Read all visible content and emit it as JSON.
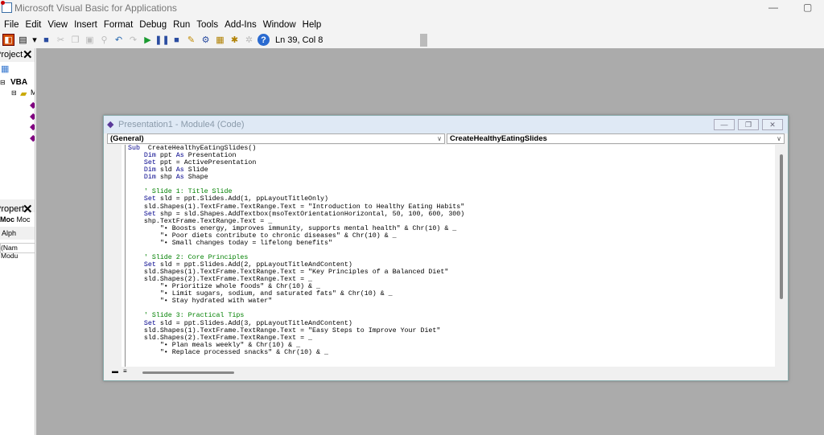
{
  "app_title": "Microsoft Visual Basic for Applications",
  "menu": [
    "File",
    "Edit",
    "View",
    "Insert",
    "Format",
    "Debug",
    "Run",
    "Tools",
    "Add-Ins",
    "Window",
    "Help"
  ],
  "status": "Ln 39, Col 8",
  "project_panel": {
    "title": "Project",
    "root": "VBA",
    "folder": "M"
  },
  "properties_panel": {
    "title": "Propert",
    "object_label": "Moc",
    "object_combo": "Moc",
    "tab": "Alph",
    "name_row": "(Nam Modu"
  },
  "code_window": {
    "title": "Presentation1 - Module4 (Code)",
    "object_combo": "(General)",
    "proc_combo": "CreateHealthyEatingSlides",
    "lines": [
      [
        [
          "kw",
          "Sub"
        ],
        [
          "",
          "  CreateHealthyEatingSlides()"
        ]
      ],
      [
        [
          "",
          "    "
        ],
        [
          "kw",
          "Dim"
        ],
        [
          "",
          " ppt "
        ],
        [
          "kw",
          "As"
        ],
        [
          "",
          " Presentation"
        ]
      ],
      [
        [
          "",
          "    "
        ],
        [
          "kw",
          "Set"
        ],
        [
          "",
          " ppt = ActivePresentation"
        ]
      ],
      [
        [
          "",
          "    "
        ],
        [
          "kw",
          "Dim"
        ],
        [
          "",
          " sld "
        ],
        [
          "kw",
          "As"
        ],
        [
          "",
          " Slide"
        ]
      ],
      [
        [
          "",
          "    "
        ],
        [
          "kw",
          "Dim"
        ],
        [
          "",
          " shp "
        ],
        [
          "kw",
          "As"
        ],
        [
          "",
          " Shape"
        ]
      ],
      [
        [
          "",
          ""
        ]
      ],
      [
        [
          "cm",
          "    ' Slide 1: Title Slide"
        ]
      ],
      [
        [
          "",
          "    "
        ],
        [
          "kw",
          "Set"
        ],
        [
          "",
          " sld = ppt.Slides.Add(1, ppLayoutTitleOnly)"
        ]
      ],
      [
        [
          "",
          "    sld.Shapes(1).TextFrame.TextRange.Text = \"Introduction to Healthy Eating Habits\""
        ]
      ],
      [
        [
          "",
          "    "
        ],
        [
          "kw",
          "Set"
        ],
        [
          "",
          " shp = sld.Shapes.AddTextbox(msoTextOrientationHorizontal, 50, 100, 600, 300)"
        ]
      ],
      [
        [
          "",
          "    shp.TextFrame.TextRange.Text = _"
        ]
      ],
      [
        [
          "",
          "        \"• Boosts energy, improves immunity, supports mental health\" & Chr(10) & _"
        ]
      ],
      [
        [
          "",
          "        \"• Poor diets contribute to chronic diseases\" & Chr(10) & _"
        ]
      ],
      [
        [
          "",
          "        \"• Small changes today = lifelong benefits\""
        ]
      ],
      [
        [
          "",
          ""
        ]
      ],
      [
        [
          "cm",
          "    ' Slide 2: Core Principles"
        ]
      ],
      [
        [
          "",
          "    "
        ],
        [
          "kw",
          "Set"
        ],
        [
          "",
          " sld = ppt.Slides.Add(2, ppLayoutTitleAndContent)"
        ]
      ],
      [
        [
          "",
          "    sld.Shapes(1).TextFrame.TextRange.Text = \"Key Principles of a Balanced Diet\""
        ]
      ],
      [
        [
          "",
          "    sld.Shapes(2).TextFrame.TextRange.Text = _"
        ]
      ],
      [
        [
          "",
          "        \"• Prioritize whole foods\" & Chr(10) & _"
        ]
      ],
      [
        [
          "",
          "        \"• Limit sugars, sodium, and saturated fats\" & Chr(10) & _"
        ]
      ],
      [
        [
          "",
          "        \"• Stay hydrated with water\""
        ]
      ],
      [
        [
          "",
          ""
        ]
      ],
      [
        [
          "cm",
          "    ' Slide 3: Practical Tips"
        ]
      ],
      [
        [
          "",
          "    "
        ],
        [
          "kw",
          "Set"
        ],
        [
          "",
          " sld = ppt.Slides.Add(3, ppLayoutTitleAndContent)"
        ]
      ],
      [
        [
          "",
          "    sld.Shapes(1).TextFrame.TextRange.Text = \"Easy Steps to Improve Your Diet\""
        ]
      ],
      [
        [
          "",
          "    sld.Shapes(2).TextFrame.TextRange.Text = _"
        ]
      ],
      [
        [
          "",
          "        \"• Plan meals weekly\" & Chr(10) & _"
        ]
      ],
      [
        [
          "",
          "        \"• Replace processed snacks\" & Chr(10) & _"
        ]
      ]
    ]
  }
}
